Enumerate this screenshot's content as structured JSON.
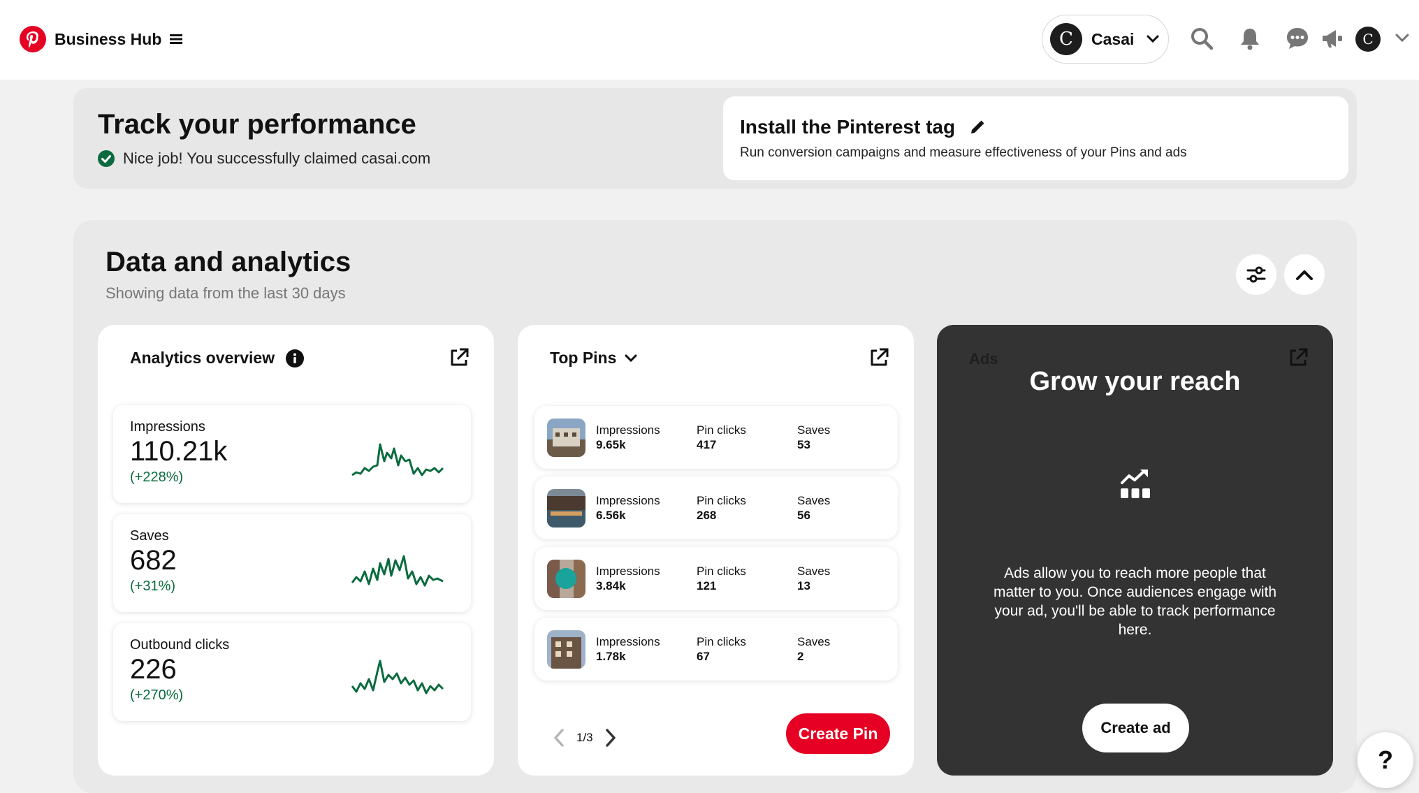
{
  "header": {
    "brand": "Business Hub",
    "account_name": "Casai",
    "avatar_letter": "C"
  },
  "performance": {
    "title": "Track your performance",
    "claimed_message": "Nice job! You successfully claimed casai.com",
    "tag_title": "Install the Pinterest tag",
    "tag_description": "Run conversion campaigns and measure effectiveness of your Pins and ads"
  },
  "analytics": {
    "title": "Data and analytics",
    "subtitle": "Showing data from the last 30 days",
    "overview": {
      "title": "Analytics overview",
      "metrics": [
        {
          "label": "Impressions",
          "value": "110.21k",
          "change": "(+228%)"
        },
        {
          "label": "Saves",
          "value": "682",
          "change": "(+31%)"
        },
        {
          "label": "Outbound clicks",
          "value": "226",
          "change": "(+270%)"
        }
      ]
    },
    "top_pins": {
      "title": "Top Pins",
      "pins": [
        {
          "impressions_label": "Impressions",
          "impressions": "9.65k",
          "clicks_label": "Pin clicks",
          "clicks": "417",
          "saves_label": "Saves",
          "saves": "53"
        },
        {
          "impressions_label": "Impressions",
          "impressions": "6.56k",
          "clicks_label": "Pin clicks",
          "clicks": "268",
          "saves_label": "Saves",
          "saves": "56"
        },
        {
          "impressions_label": "Impressions",
          "impressions": "3.84k",
          "clicks_label": "Pin clicks",
          "clicks": "121",
          "saves_label": "Saves",
          "saves": "13"
        },
        {
          "impressions_label": "Impressions",
          "impressions": "1.78k",
          "clicks_label": "Pin clicks",
          "clicks": "67",
          "saves_label": "Saves",
          "saves": "2"
        }
      ],
      "page_indicator": "1/3",
      "create_pin_label": "Create Pin"
    },
    "ads": {
      "label": "Ads",
      "title": "Grow your reach",
      "description": "Ads allow you to reach more people that matter to you. Once audiences engage with your ad, you'll be able to track performance here.",
      "button_label": "Create ad"
    }
  },
  "help_label": "?",
  "colors": {
    "brand_red": "#e60023",
    "positive_green": "#0a6b3e",
    "ads_bg": "#333333"
  }
}
